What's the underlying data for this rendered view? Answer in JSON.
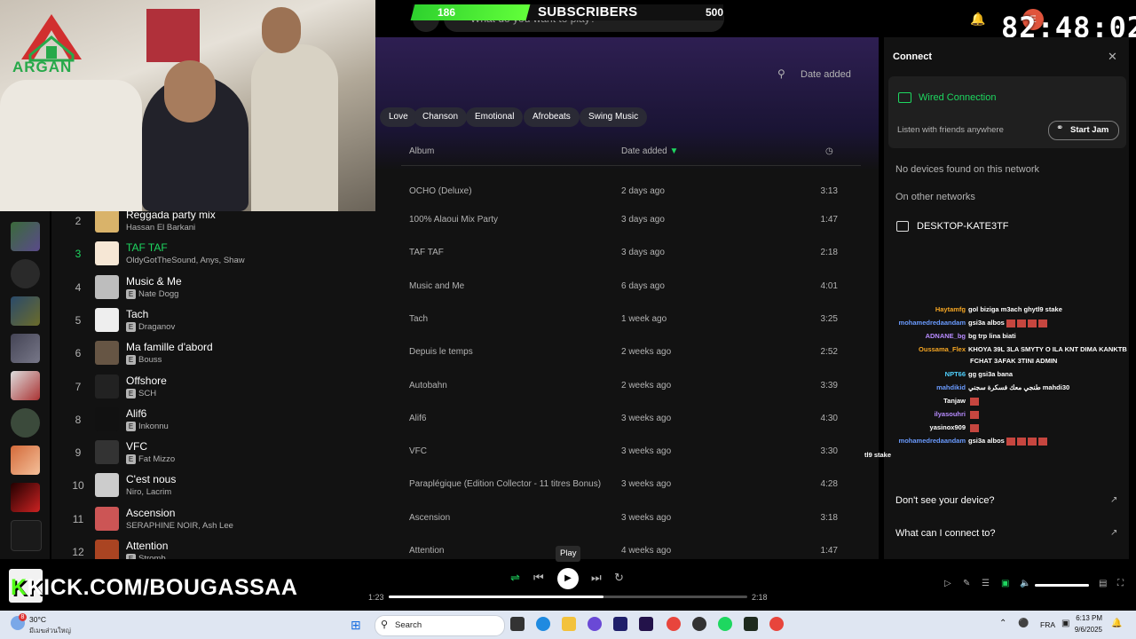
{
  "top": {
    "search_placeholder": "What do you want to play?",
    "subs_count": "186",
    "subs_label": "SUBSCRIBERS",
    "subs_goal": "500",
    "subs_progress": 0.372,
    "timer": "82:48:02",
    "avatar_letter": "E"
  },
  "webcam": {
    "logo_text": "ARGAN"
  },
  "playlist": {
    "sort_label": "Date added",
    "chips": [
      "Love",
      "Chanson",
      "Emotional",
      "Afrobeats",
      "Swing Music"
    ],
    "headers": {
      "album": "Album",
      "date": "Date added"
    },
    "tracks": [
      {
        "num": "2",
        "title": "Reggada party mix",
        "artist": "Hassan El Barkani",
        "explicit": false,
        "album": "100% Alaoui Mix Party",
        "date": "3 days ago",
        "dur": "1:47"
      },
      {
        "num": "3",
        "title": "TAF TAF",
        "artist": "OldyGotTheSound, Anys, Shaw",
        "explicit": false,
        "album": "TAF TAF",
        "date": "3 days ago",
        "dur": "2:18",
        "active": true
      },
      {
        "num": "4",
        "title": "Music & Me",
        "artist": "Nate Dogg",
        "explicit": true,
        "album": "Music and Me",
        "date": "6 days ago",
        "dur": "4:01"
      },
      {
        "num": "5",
        "title": "Tach",
        "artist": "Draganov",
        "explicit": true,
        "album": "Tach",
        "date": "1 week ago",
        "dur": "3:25"
      },
      {
        "num": "6",
        "title": "Ma famille d'abord",
        "artist": "Bouss",
        "explicit": true,
        "album": "Depuis le temps",
        "date": "2 weeks ago",
        "dur": "2:52"
      },
      {
        "num": "7",
        "title": "Offshore",
        "artist": "SCH",
        "explicit": true,
        "album": "Autobahn",
        "date": "2 weeks ago",
        "dur": "3:39"
      },
      {
        "num": "8",
        "title": "Alif6",
        "artist": "Inkonnu",
        "explicit": true,
        "album": "Alif6",
        "date": "3 weeks ago",
        "dur": "4:30"
      },
      {
        "num": "9",
        "title": "VFC",
        "artist": "Fat Mizzo",
        "explicit": true,
        "album": "VFC",
        "date": "3 weeks ago",
        "dur": "3:30"
      },
      {
        "num": "10",
        "title": "C'est nous",
        "artist": "Niro, Lacrim",
        "explicit": false,
        "album": "Paraplégique (Edition Collector - 11 titres Bonus)",
        "date": "3 weeks ago",
        "dur": "4:28"
      },
      {
        "num": "11",
        "title": "Ascension",
        "artist": "SERAPHINE NOIR, Ash Lee",
        "explicit": false,
        "album": "Ascension",
        "date": "3 weeks ago",
        "dur": "3:18"
      },
      {
        "num": "12",
        "title": "Attention",
        "artist": "Stromb",
        "explicit": true,
        "album": "Attention",
        "date": "4 weeks ago",
        "dur": "1:47"
      }
    ],
    "first_row": {
      "album": "OCHO (Deluxe)",
      "date": "2 days ago",
      "dur": "3:13"
    }
  },
  "connect": {
    "title": "Connect",
    "wired": "Wired Connection",
    "listen": "Listen with friends anywhere",
    "jam": "Start Jam",
    "no_devices": "No devices found on this network",
    "other_networks": "On other networks",
    "desktop": "DESKTOP-KATE3TF",
    "dont_see": "Don't see your device?",
    "what_connect": "What can I connect to?"
  },
  "chat": [
    {
      "user": "Haytamfg",
      "color": "#f5a623",
      "msg": "gol biziga m3ach ghytl9 stake"
    },
    {
      "user": "mohamedredaandam",
      "color": "#6a9bff",
      "msg": "gsi3a albos"
    },
    {
      "user": "ADNANE_bg",
      "color": "#b78bff",
      "msg": "bg trp lina biati"
    },
    {
      "user": "Oussama_Flex",
      "color": "#f5a623",
      "msg": "KHOYA 39L 3LA SMYTY O ILA KNT DIMA KANKTB"
    },
    {
      "user": "",
      "color": "#ffffff",
      "msg": "FCHAT 3AFAK 3TINI ADMIN"
    },
    {
      "user": "NPT66",
      "color": "#4fd1ff",
      "msg": "gg gsi3a bana"
    },
    {
      "user": "mahdikid",
      "color": "#6a9bff",
      "msg": "طنجي معك فسكرة سجني mahdi30"
    },
    {
      "user": "Tanjaw",
      "color": "#ffffff",
      "msg": ""
    },
    {
      "user": "ilyasouhri",
      "color": "#b78bff",
      "msg": ""
    },
    {
      "user": "yasinox909",
      "color": "#ffffff",
      "msg": ""
    },
    {
      "user": "mohamedredaandam",
      "color": "#6a9bff",
      "msg": "gsi3a albos"
    }
  ],
  "chat_overflow": "tl9 stake",
  "player": {
    "kick_prefix": "K",
    "kick_text": "KICK.COM/BOUGASSAA",
    "tooltip": "Play",
    "current": "1:23",
    "total": "2:18",
    "progress": 0.6,
    "volume": 1.0
  },
  "taskbar": {
    "weather_temp": "30°C",
    "weather_desc": "มีเมฆส่วนใหญ่",
    "weather_badge": "8",
    "search": "Search",
    "lang": "FRA",
    "time": "6:13 PM",
    "date": "9/6/2025"
  }
}
